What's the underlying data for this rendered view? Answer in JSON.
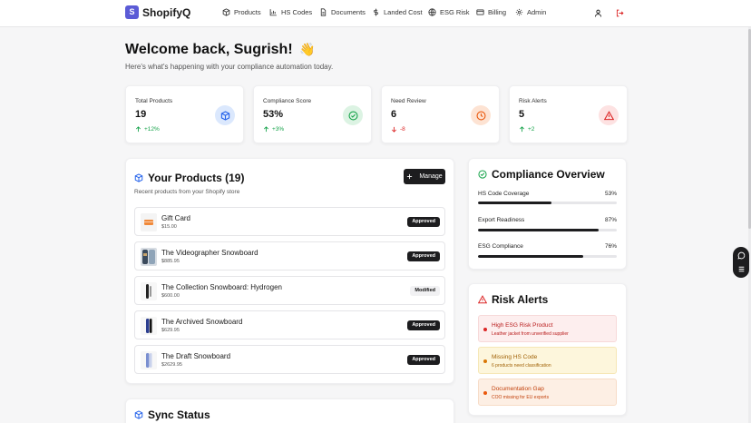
{
  "app": {
    "logo_letter": "S",
    "name": "ShopifyQ"
  },
  "nav": [
    {
      "label": "Products",
      "icon": "box-icon"
    },
    {
      "label": "HS Codes",
      "icon": "bar-chart-icon"
    },
    {
      "label": "Documents",
      "icon": "document-icon"
    },
    {
      "label": "Landed Cost",
      "icon": "dollar-icon"
    },
    {
      "label": "ESG Risk",
      "icon": "globe-icon"
    },
    {
      "label": "Billing",
      "icon": "credit-card-icon"
    },
    {
      "label": "Admin",
      "icon": "gear-icon"
    }
  ],
  "welcome": {
    "title": "Welcome back, Sugrish!",
    "emoji": "👋",
    "subtitle": "Here's what's happening with your compliance automation today."
  },
  "stats": [
    {
      "label": "Total Products",
      "value": "19",
      "change": "+12%",
      "direction": "up",
      "color": "#3b82f6",
      "icon": "cube-icon"
    },
    {
      "label": "Compliance Score",
      "value": "53%",
      "change": "+3%",
      "direction": "up",
      "color": "#16a34a",
      "icon": "check-circle-icon"
    },
    {
      "label": "Need Review",
      "value": "6",
      "change": "-8",
      "direction": "down",
      "color": "#ea580c",
      "icon": "clock-icon"
    },
    {
      "label": "Risk Alerts",
      "value": "5",
      "change": "+2",
      "direction": "up",
      "color": "#dc2626",
      "icon": "warning-icon"
    }
  ],
  "products_panel": {
    "title": "Your Products (19)",
    "subtitle": "Recent products from your Shopify store",
    "manage_label": "Manage",
    "items": [
      {
        "name": "Gift Card",
        "price": "$15.00",
        "status": "Approved"
      },
      {
        "name": "The Videographer Snowboard",
        "price": "$885.95",
        "status": "Approved"
      },
      {
        "name": "The Collection Snowboard: Hydrogen",
        "price": "$600.00",
        "status": "Modified"
      },
      {
        "name": "The Archived Snowboard",
        "price": "$629.95",
        "status": "Approved"
      },
      {
        "name": "The Draft Snowboard",
        "price": "$2629.95",
        "status": "Approved"
      }
    ]
  },
  "compliance": {
    "title": "Compliance Overview",
    "metrics": [
      {
        "label": "HS Code Coverage",
        "value": "53%",
        "fraction": 0.53
      },
      {
        "label": "Export Readiness",
        "value": "87%",
        "fraction": 0.87
      },
      {
        "label": "ESG Compliance",
        "value": "76%",
        "fraction": 0.76
      }
    ]
  },
  "risk_alerts": {
    "title": "Risk Alerts",
    "items": [
      {
        "title": "High ESG Risk Product",
        "desc": "Leather jacket from unverified supplier",
        "level": "high"
      },
      {
        "title": "Missing HS Code",
        "desc": "6 products need classification",
        "level": "medium"
      },
      {
        "title": "Documentation Gap",
        "desc": "COO missing for EU exports",
        "level": "low"
      }
    ]
  },
  "sync": {
    "title": "Sync Status"
  },
  "colors": {
    "accent": "#5b5bd6",
    "dark": "#1d1d1f",
    "alert_red": "#dc2626",
    "alert_amber": "#d97706",
    "alert_orange": "#ea580c"
  }
}
